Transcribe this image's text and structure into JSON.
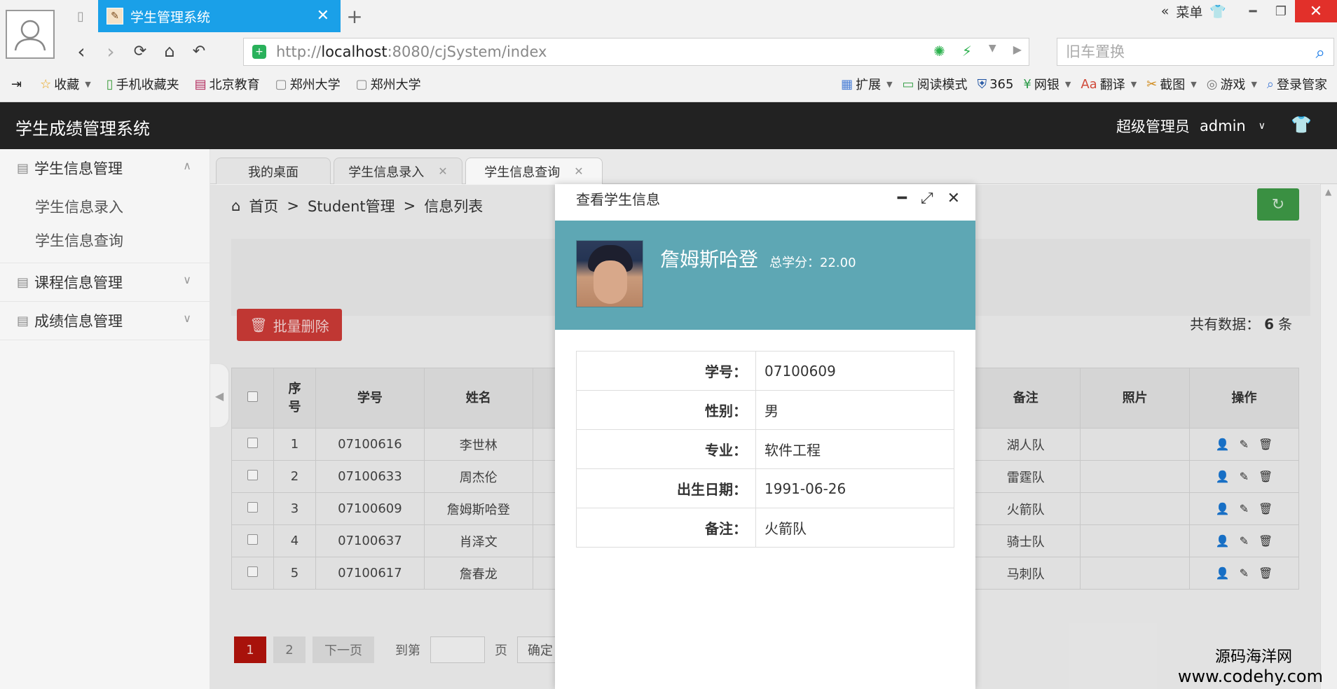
{
  "browser": {
    "tab_title": "学生管理系统",
    "url_scheme": "http://",
    "url_host": "localhost",
    "url_path": ":8080/cjSystem/index",
    "search_placeholder": "旧车置换",
    "menu_label": "菜单",
    "bookmarks": [
      "收藏",
      "手机收藏夹",
      "北京教育",
      "郑州大学",
      "郑州大学"
    ],
    "toolbar_items": [
      "扩展",
      "阅读模式",
      "365",
      "网银",
      "翻译",
      "截图",
      "游戏",
      "登录管家"
    ]
  },
  "app": {
    "title": "学生成绩管理系统",
    "role": "超级管理员",
    "username": "admin"
  },
  "sidebar": {
    "groups": [
      {
        "label": "学生信息管理",
        "items": [
          "学生信息录入",
          "学生信息查询"
        ]
      },
      {
        "label": "课程信息管理"
      },
      {
        "label": "成绩信息管理"
      }
    ]
  },
  "page_tabs": [
    "我的桌面",
    "学生信息录入",
    "学生信息查询"
  ],
  "breadcrumb": [
    "首页",
    "Student管理",
    "信息列表"
  ],
  "toolbar": {
    "batch_delete": "批量删除",
    "total_prefix": "共有数据：",
    "total_count": "6",
    "total_suffix": "条"
  },
  "table": {
    "headers": {
      "seq": "序号",
      "id": "学号",
      "name": "姓名",
      "remark": "备注",
      "photo": "照片",
      "ops": "操作"
    },
    "rows": [
      {
        "seq": "1",
        "id": "07100616",
        "name": "李世林",
        "remark": "湖人队"
      },
      {
        "seq": "2",
        "id": "07100633",
        "name": "周杰伦",
        "remark": "雷霆队"
      },
      {
        "seq": "3",
        "id": "07100609",
        "name": "詹姆斯哈登",
        "remark": "火箭队"
      },
      {
        "seq": "4",
        "id": "07100637",
        "name": "肖泽文",
        "remark": "骑士队"
      },
      {
        "seq": "5",
        "id": "07100617",
        "name": "詹春龙",
        "remark": "马刺队"
      }
    ]
  },
  "pager": {
    "page1": "1",
    "page2": "2",
    "next": "下一页",
    "goto": "到第",
    "page_unit": "页",
    "confirm": "确定"
  },
  "modal": {
    "title": "查看学生信息",
    "name": "詹姆斯哈登",
    "credit": "总学分：22.00",
    "fields": [
      {
        "key": "学号：",
        "value": "07100609"
      },
      {
        "key": "性别：",
        "value": "男"
      },
      {
        "key": "专业：",
        "value": "软件工程"
      },
      {
        "key": "出生日期：",
        "value": "1991-06-26"
      },
      {
        "key": "备注：",
        "value": "火箭队"
      }
    ]
  },
  "watermark": {
    "line1": "源码海洋网",
    "line2": "www.codehy.com"
  },
  "colors": {
    "tab_blue": "#1aa0e8",
    "header_dark": "#222222",
    "banner_teal": "#5ea7b4",
    "danger_red": "#cc3b37",
    "success_green": "#3e9a47"
  }
}
